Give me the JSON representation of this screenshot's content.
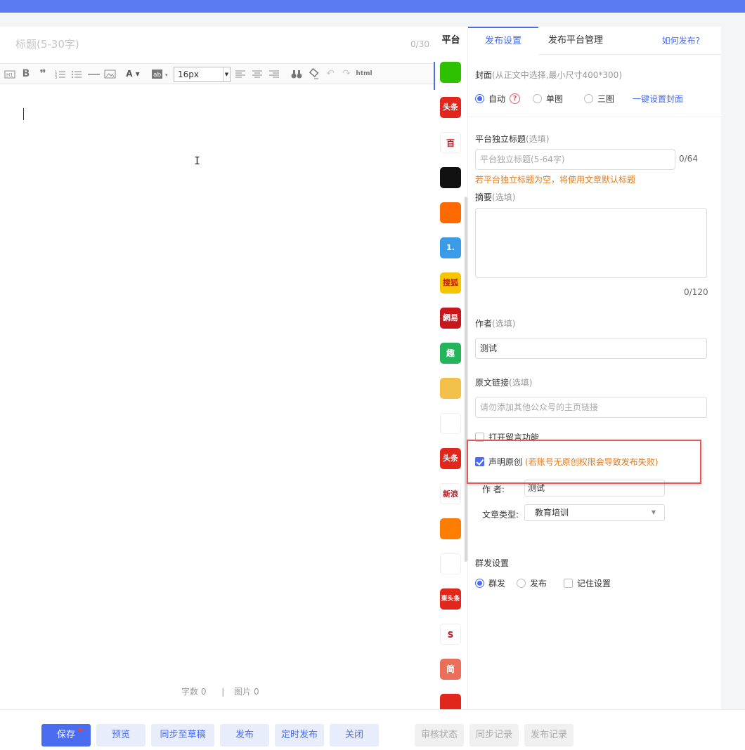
{
  "editor": {
    "title_placeholder": "标题(5-30字)",
    "title_count": "0/30",
    "font_size": "16px",
    "toolbar_html_label": "html",
    "stats_words": "字数 0",
    "stats_sep": "|",
    "stats_images": "图片 0"
  },
  "platforms": {
    "header": "平台",
    "items": [
      {
        "name": "wechat-icon",
        "text": "",
        "color": "#2dc100"
      },
      {
        "name": "toutiao-icon",
        "text": "头条",
        "color": "#e1261c"
      },
      {
        "name": "baijiahao-icon",
        "text": "百",
        "color": "#ffffff"
      },
      {
        "name": "qq-icon",
        "text": "",
        "color": "#111111"
      },
      {
        "name": "dayu-icon",
        "text": "",
        "color": "#ff6a00"
      },
      {
        "name": "yidian-icon",
        "text": "1.",
        "color": "#3a9be8"
      },
      {
        "name": "sohu-icon",
        "text": "搜狐",
        "color": "#f5c500"
      },
      {
        "name": "netease-icon",
        "text": "網易",
        "color": "#c8161d"
      },
      {
        "name": "qutoutiao-icon",
        "text": "趣",
        "color": "#24b45a"
      },
      {
        "name": "weibo-icon",
        "text": "",
        "color": "#f3c14a"
      },
      {
        "name": "aiqiyi-icon",
        "text": "",
        "color": "#ffffff"
      },
      {
        "name": "toutiao2-icon",
        "text": "头条",
        "color": "#e1261c"
      },
      {
        "name": "sina-icon",
        "text": "新浪",
        "color": "#ffffff"
      },
      {
        "name": "zhihu-icon",
        "text": "",
        "color": "#ff7d00"
      },
      {
        "name": "fenghuang-icon",
        "text": "",
        "color": "#ffffff"
      },
      {
        "name": "dongtoutiao-icon",
        "text": "東头条",
        "color": "#e1261c"
      },
      {
        "name": "sougou-icon",
        "text": "S",
        "color": "#ffffff"
      },
      {
        "name": "jianshu-icon",
        "text": "简",
        "color": "#ea6f5a"
      },
      {
        "name": "jinri-icon",
        "text": "",
        "color": "#e1261c"
      }
    ]
  },
  "panel": {
    "tabs": [
      "发布设置",
      "发布平台管理"
    ],
    "help": "如何发布?",
    "cover_label": "封面",
    "cover_hint": "(从正文中选择,最小尺寸400*300)",
    "cover_options": [
      "自动",
      "单图",
      "三图"
    ],
    "cover_help_icon": "?",
    "cover_link": "一键设置封面",
    "title_label": "平台独立标题",
    "optional": "(选填)",
    "title_placeholder": "平台独立标题(5-64字)",
    "title_count": "0/64",
    "title_warn": "若平台独立标题为空，将使用文章默认标题",
    "summary_label": "摘要",
    "summary_count": "0/120",
    "author_label": "作者",
    "author_value": "测试",
    "source_label": "原文链接",
    "source_placeholder": "请勿添加其他公众号的主页链接",
    "comment_label": "打开留言功能",
    "original_label": "声明原创",
    "original_warn": "(若账号无原创权限会导致发布失败)",
    "orig_author_label": "作    者:",
    "orig_author_value": "测试",
    "article_type_label": "文章类型:",
    "article_type_value": "教育培训",
    "mass_label": "群发设置",
    "mass_options": [
      "群发",
      "发布"
    ],
    "remember_label": "记住设置"
  },
  "bottom": {
    "save": "保存",
    "preview": "预览",
    "sync_draft": "同步至草稿",
    "publish": "发布",
    "schedule": "定时发布",
    "close": "关闭",
    "review_status": "审核状态",
    "sync_log": "同步记录",
    "publish_log": "发布记录"
  }
}
